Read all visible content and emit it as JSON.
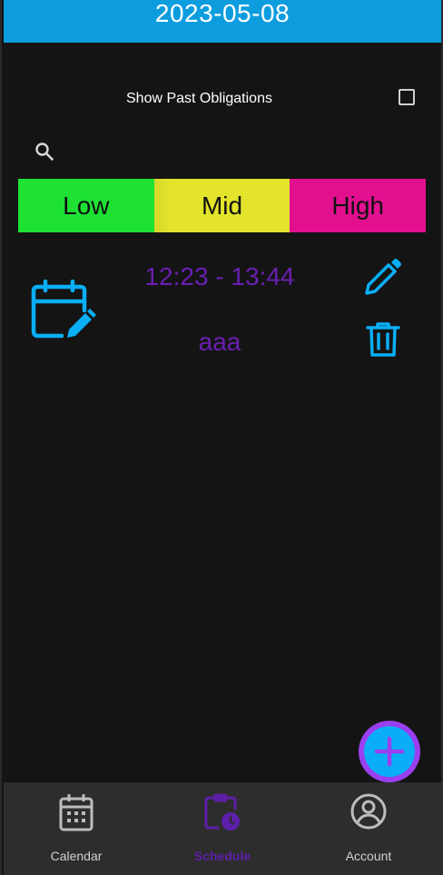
{
  "header": {
    "date": "2023-05-08"
  },
  "filters": {
    "show_past_label": "Show Past Obligations",
    "show_past_checked": false
  },
  "search": {
    "icon": "search-icon"
  },
  "priorities": [
    {
      "label": "Low",
      "color": "#1de233"
    },
    {
      "label": "Mid",
      "color": "#e3e42b"
    },
    {
      "label": "High",
      "color": "#e20f8f"
    }
  ],
  "obligations": [
    {
      "time": "12:23 - 13:44",
      "title": "aaa",
      "icon": "calendar-edit-icon"
    }
  ],
  "fab": {
    "icon": "plus-icon",
    "color": "#09aef6",
    "ring_color": "#9a3ff0"
  },
  "nav": [
    {
      "label": "Calendar",
      "icon": "calendar-icon",
      "active": false
    },
    {
      "label": "Schedule",
      "icon": "schedule-icon",
      "active": true
    },
    {
      "label": "Account",
      "icon": "account-icon",
      "active": false
    }
  ],
  "colors": {
    "accent": "#0d9ddf",
    "text_purple": "#6a1fb0",
    "icon_blue": "#09aef6"
  }
}
